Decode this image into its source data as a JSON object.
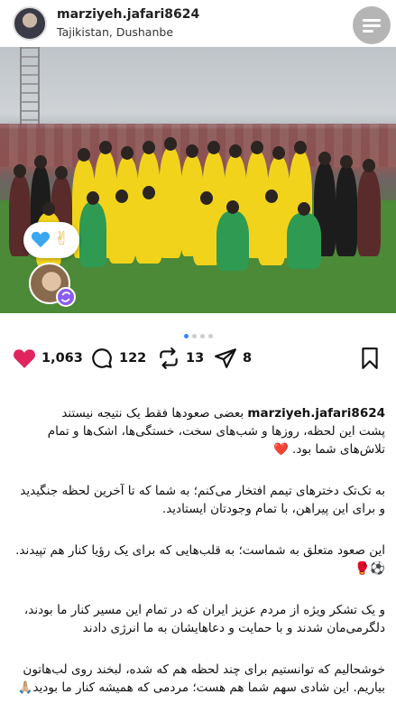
{
  "post": {
    "username": "marziyeh.jafari8624",
    "location": "Tajikistan, Dushanbe"
  },
  "icons": {
    "menu": "menu-lines-icon",
    "like": "heart-icon",
    "comment": "comment-bubble-icon",
    "repost": "repost-arrows-icon",
    "share": "send-icon",
    "bookmark": "bookmark-icon",
    "reaction_heart": "blue-heart-icon",
    "reaction_victory": "victory-hand-icon"
  },
  "colors": {
    "like": "#e0245e",
    "dot_active": "#3b82f6",
    "dot_inactive": "#cccccc",
    "jersey": "#f2d31b",
    "keeper": "#2f9a52"
  },
  "carousel": {
    "total": 4,
    "active": 1
  },
  "actions": {
    "likes": "1,063",
    "comments": "122",
    "reposts": "13",
    "shares": "8"
  },
  "caption": {
    "first_text": "بعضی صعودها فقط یک نتیجه نیستند",
    "lines": [
      "پشت این لحظه، روزها و شب‌های سخت، خستگی‌ها، اشک‌ها و تمام تلاش‌های شما بود. ❤️",
      "به تک‌تک دخترهای تیمم افتخار می‌کنم؛ به شما که تا آخرین لحظه جنگیدید و برای این پیراهن، با تمام وجودتان ایستادید.",
      "این صعود متعلق به شماست؛ به قلب‌هایی که برای یک رؤیا کنار هم تپیدند. ⚽️🥊",
      "و یک تشکر ویژه از مردم عزیز ایران که در تمام این مسیر کنار ما بودند، دلگرمی‌مان شدند و با حمایت و دعاهایشان به ما انرژی دادند",
      "خوشحالیم که توانستیم برای چند لحظه هم که شده، لبخند روی لب‌هاتون بیاریم. این شادی سهم شما هم هست؛ مردمی که همیشه کنار ما بودید🙏🏼"
    ]
  }
}
